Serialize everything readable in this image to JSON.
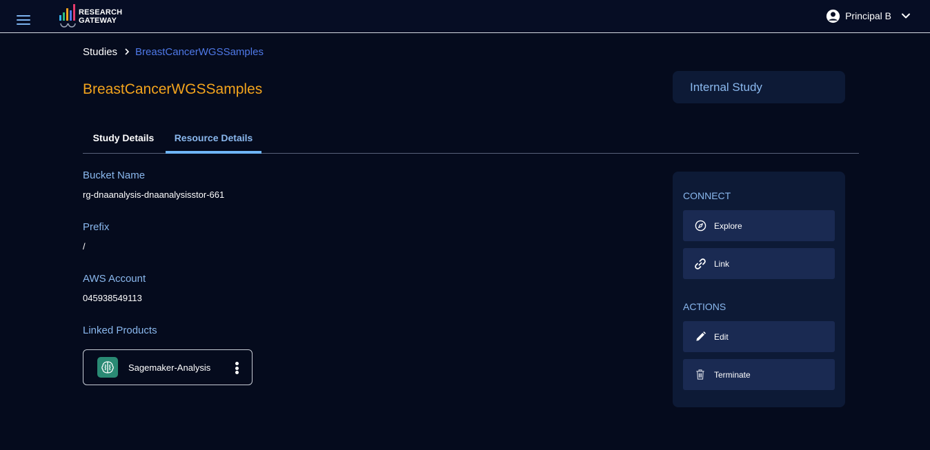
{
  "header": {
    "logo_line1": "RESEARCH",
    "logo_line2": "GATEWAY",
    "user_name": "Principal B",
    "menu_icon": "hamburger-menu-icon",
    "user_icon": "account-circle-icon",
    "dropdown_icon": "chevron-down-icon"
  },
  "breadcrumb": {
    "root": "Studies",
    "current": "BreastCancerWGSSamples"
  },
  "page": {
    "title": "BreastCancerWGSSamples",
    "study_type": "Internal Study"
  },
  "tabs": [
    {
      "label": "Study Details",
      "active": false
    },
    {
      "label": "Resource Details",
      "active": true
    }
  ],
  "details": {
    "bucket_label": "Bucket Name",
    "bucket_value": "rg-dnaanalysis-dnaanalysisstor-661",
    "prefix_label": "Prefix",
    "prefix_value": "/",
    "aws_label": "AWS Account",
    "aws_value": "045938549113",
    "linked_label": "Linked Products"
  },
  "linked_products": [
    {
      "name": "Sagemaker-Analysis",
      "icon": "sagemaker-brain-icon"
    }
  ],
  "side_panel": {
    "connect_title": "CONNECT",
    "connect_actions": [
      {
        "label": "Explore",
        "icon": "compass-icon"
      },
      {
        "label": "Link",
        "icon": "link-icon"
      }
    ],
    "actions_title": "ACTIONS",
    "actions": [
      {
        "label": "Edit",
        "icon": "pencil-icon"
      },
      {
        "label": "Terminate",
        "icon": "trash-icon"
      }
    ]
  },
  "colors": {
    "background": "#050b1d",
    "title_accent": "#f3a41d",
    "label_blue": "#8ab8ee",
    "breadcrumb_link": "#4f79e8",
    "panel": "#0d1a36",
    "button": "#1a2a52"
  }
}
